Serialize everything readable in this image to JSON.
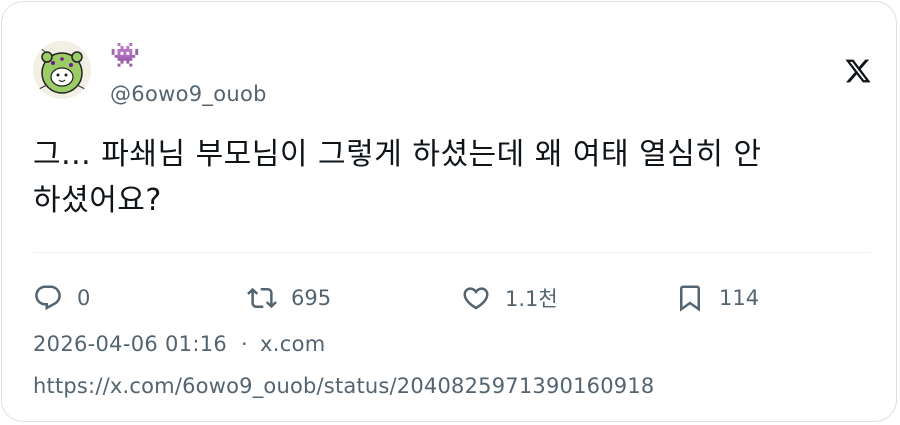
{
  "tweet": {
    "display_name": "👾",
    "handle": "@6owo9_ouob",
    "text_line1": "그... 파쇄님 부모님이 그렇게 하셨는데 왜 여태 열심히 안",
    "text_line2": "하셨어요?"
  },
  "actions": {
    "reply": {
      "icon": "reply-icon",
      "count": "0"
    },
    "retweet": {
      "icon": "retweet-icon",
      "count": "695"
    },
    "like": {
      "icon": "heart-icon",
      "count": "1.1천"
    },
    "bookmark": {
      "icon": "bookmark-icon",
      "count": "114"
    }
  },
  "meta": {
    "timestamp": "2026-04-06 01:16",
    "separator": "·",
    "source": "x.com",
    "url": "https://x.com/6owo9_ouob/status/2040825971390160918"
  },
  "colors": {
    "text": "#0f1419",
    "secondary": "#536471",
    "border": "#dcdfe3",
    "accent_purple": "#8a2be2"
  }
}
